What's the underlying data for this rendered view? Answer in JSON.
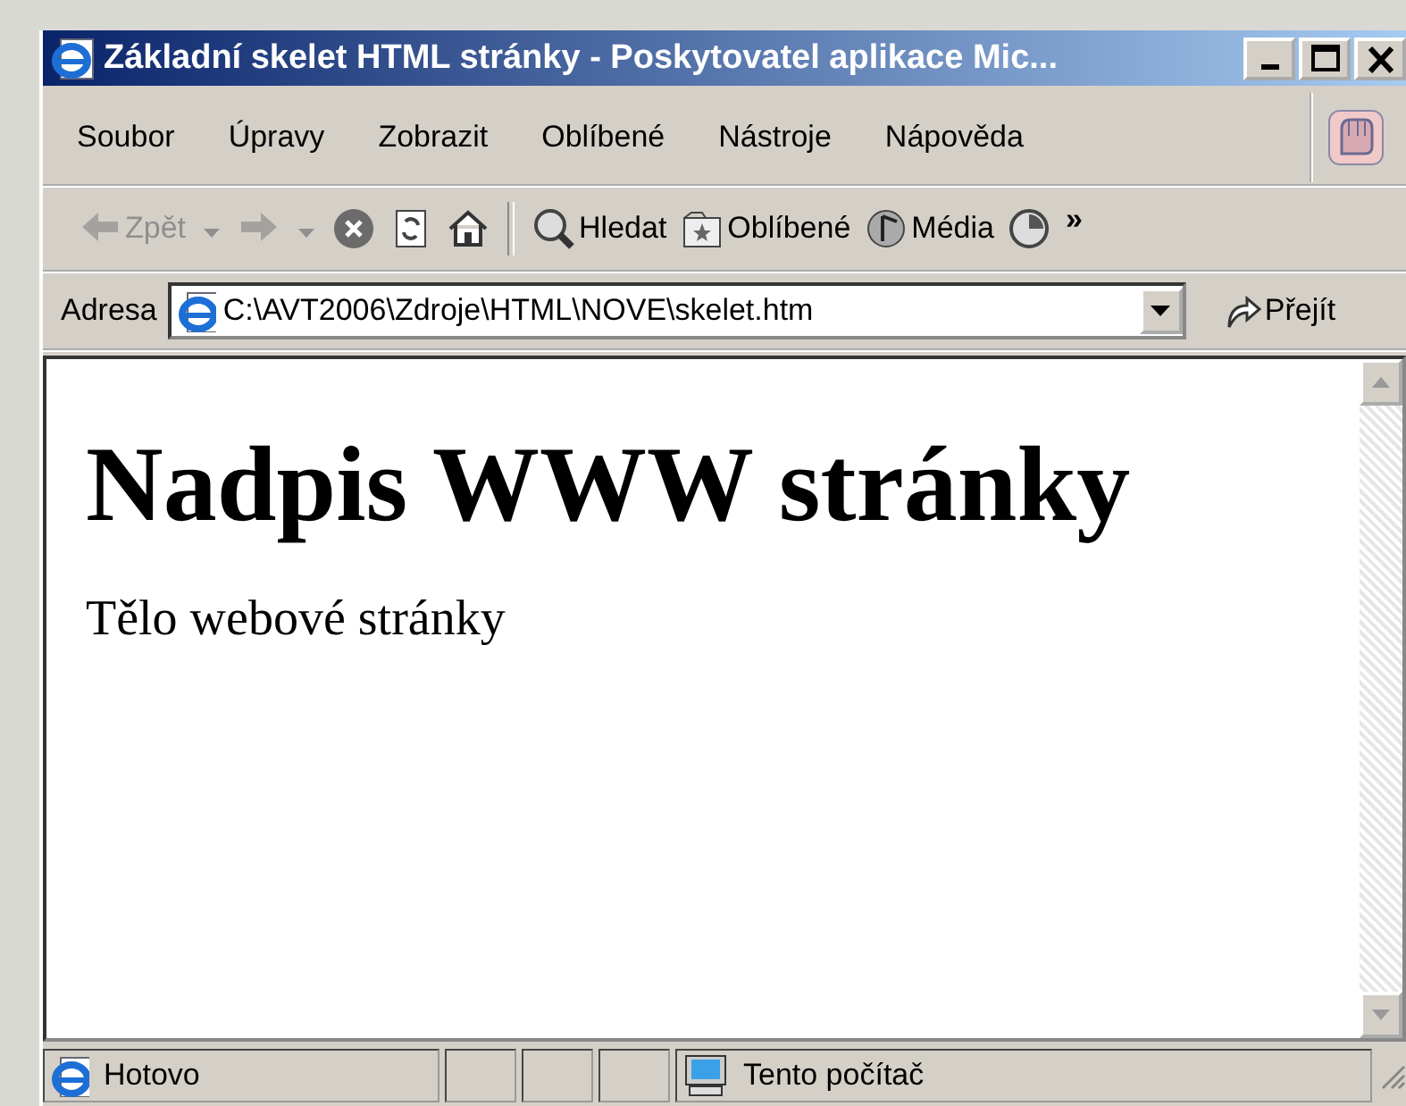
{
  "window": {
    "title": "Základní skelet HTML stránky - Poskytovatel aplikace Mic...",
    "controls": [
      {
        "kind": "minimize"
      },
      {
        "kind": "maximize"
      },
      {
        "kind": "close"
      }
    ]
  },
  "menu": [
    {
      "label": "Soubor"
    },
    {
      "label": "Úpravy"
    },
    {
      "label": "Zobrazit"
    },
    {
      "label": "Oblíbené"
    },
    {
      "label": "Nástroje"
    },
    {
      "label": "Nápověda"
    }
  ],
  "toolbar": [
    {
      "kind": "back",
      "label": "Zpět",
      "disabled": true,
      "dropdown": true
    },
    {
      "kind": "forward",
      "disabled": true,
      "dropdown": true
    },
    {
      "kind": "stop",
      "disabled": false
    },
    {
      "kind": "refresh",
      "disabled": false
    },
    {
      "kind": "home",
      "disabled": false
    },
    {
      "kind": "separator"
    },
    {
      "kind": "search",
      "label": "Hledat",
      "disabled": false
    },
    {
      "kind": "favorites",
      "label": "Oblíbené",
      "disabled": false
    },
    {
      "kind": "media",
      "label": "Média",
      "disabled": false
    },
    {
      "kind": "history",
      "disabled": false
    }
  ],
  "toolbar_more": "»",
  "address": {
    "label": "Adresa",
    "value": "C:\\AVT2006\\Zdroje\\HTML\\NOVE\\skelet.htm",
    "go": "Přejít"
  },
  "document": {
    "heading": "Nadpis WWW stránky",
    "body": "Tělo webové stránky"
  },
  "status_bar": {
    "text": "Hotovo",
    "zone": "Tento počítač"
  }
}
